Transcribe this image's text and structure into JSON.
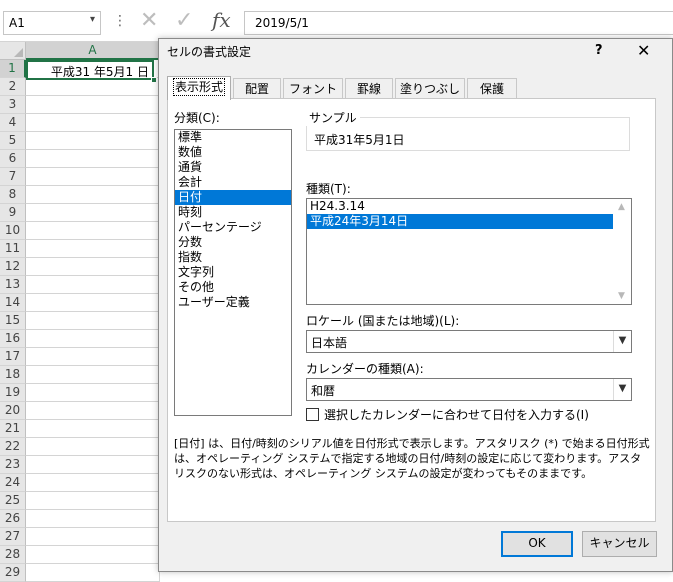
{
  "formula_bar": {
    "name_box": "A1",
    "name_box_arrow": "▾",
    "dots": "⋮",
    "cancel_icon": "✕",
    "enter_icon": "✓",
    "fx_icon": "fx",
    "formula_value": "2019/5/1"
  },
  "sheet": {
    "column_header": "A",
    "row_numbers": [
      "1",
      "2",
      "3",
      "4",
      "5",
      "6",
      "7",
      "8",
      "9",
      "10",
      "11",
      "12",
      "13",
      "14",
      "15",
      "16",
      "17",
      "18",
      "19",
      "20",
      "21",
      "22",
      "23",
      "24",
      "25",
      "26",
      "27",
      "28",
      "29"
    ],
    "cell_a1": "平成31 年5月1 日",
    "active_color": "#217346"
  },
  "dialog": {
    "title": "セルの書式設定",
    "help_label": "?",
    "close_icon": "✕",
    "tabs": [
      "表示形式",
      "配置",
      "フォント",
      "罫線",
      "塗りつぶし",
      "保護"
    ],
    "category_label": "分類(C):",
    "categories": [
      "標準",
      "数値",
      "通貨",
      "会計",
      "日付",
      "時刻",
      "パーセンテージ",
      "分数",
      "指数",
      "文字列",
      "その他",
      "ユーザー定義"
    ],
    "selected_category": "日付",
    "sample_label": "サンプル",
    "sample_value": "平成31年5月1日",
    "type_label": "種類(T):",
    "types": [
      "H24.3.14",
      "平成24年3月14日"
    ],
    "selected_type": "平成24年3月14日",
    "locale_label": "ロケール (国または地域)(L):",
    "locale_value": "日本語",
    "calendar_label": "カレンダーの種類(A):",
    "calendar_value": "和暦",
    "checkbox_label": "選択したカレンダーに合わせて日付を入力する(I)",
    "checkbox_checked": false,
    "description": "[日付] は、日付/時刻のシリアル値を日付形式で表示します。アスタリスク (*) で始まる日付形式は、オペレーティング システムで指定する地域の日付/時刻の設定に応じて変わります。アスタリスクのない形式は、オペレーティング システムの設定が変わってもそのままです。",
    "ok_label": "OK",
    "cancel_label": "キャンセル",
    "selection_color": "#0078d7"
  }
}
